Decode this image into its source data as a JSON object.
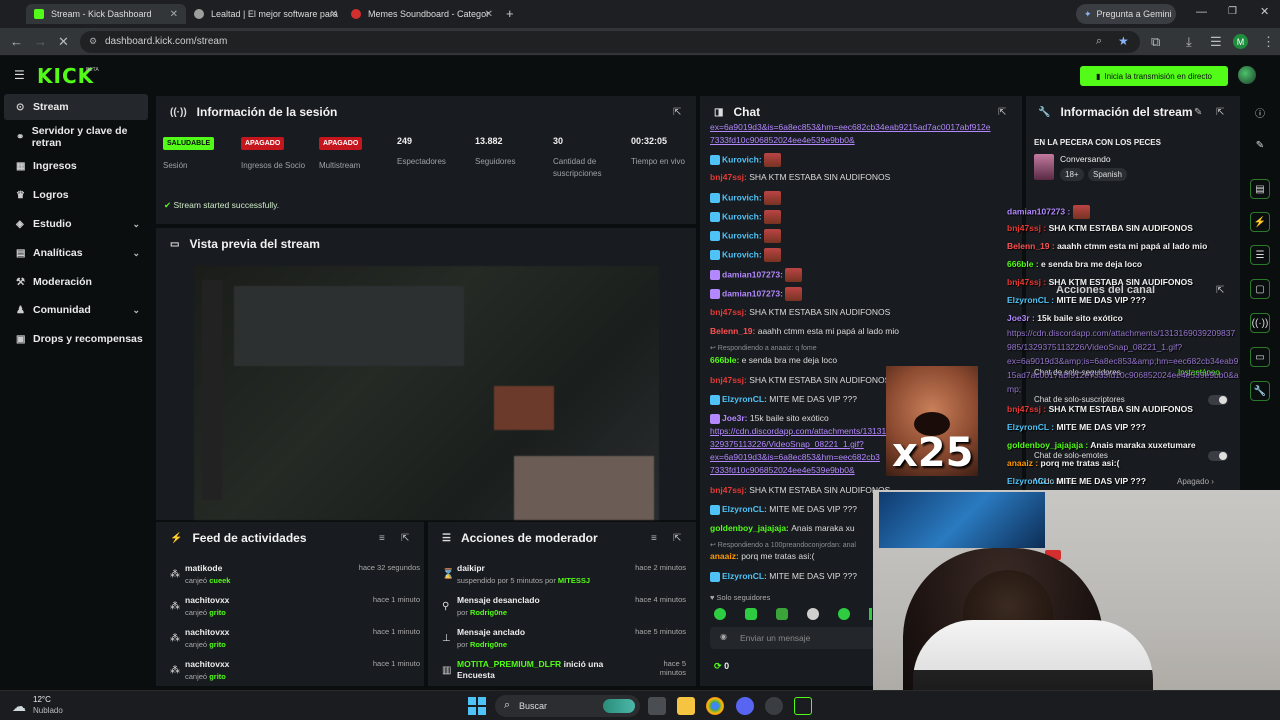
{
  "browser": {
    "tabs": [
      {
        "label": "Stream - Kick Dashboard",
        "active": true
      },
      {
        "label": "Lealtad | El mejor software para"
      },
      {
        "label": "Memes Soundboard - Categor"
      }
    ],
    "gemini_label": "Pregunta a Gemini",
    "url": "dashboard.kick.com/stream",
    "profile_initial": "M"
  },
  "kick": {
    "logo": "KICK",
    "logo_badge": "BETA",
    "go_live_label": "Inicia la transmisión en directo"
  },
  "sidebar": {
    "items": [
      {
        "label": "Stream",
        "active": true
      },
      {
        "label": "Servidor y clave de retran"
      },
      {
        "label": "Ingresos"
      },
      {
        "label": "Logros"
      },
      {
        "label": "Estudio"
      },
      {
        "label": "Analíticas"
      },
      {
        "label": "Moderación"
      },
      {
        "label": "Comunidad"
      },
      {
        "label": "Drops y recompensas"
      }
    ]
  },
  "session": {
    "title": "Información de la sesión",
    "stats": [
      {
        "badge": "SALUDABLE",
        "label": "Sesión",
        "color": "#53fc18"
      },
      {
        "badge": "APAGADO",
        "label": "Ingresos de Socio",
        "color": "#c4161c"
      },
      {
        "badge": "APAGADO",
        "label": "Multistream",
        "color": "#c4161c"
      },
      {
        "value": "249",
        "label": "Espectadores"
      },
      {
        "value": "13.882",
        "label": "Seguidores"
      },
      {
        "value": "30",
        "label": "Cantidad de suscripciones"
      },
      {
        "value": "00:32:05",
        "label": "Tiempo en vivo"
      }
    ],
    "status_message": "Stream started successfully."
  },
  "preview": {
    "title": "Vista previa del stream"
  },
  "feed": {
    "title": "Feed de actividades",
    "items": [
      {
        "user": "matikode",
        "action": "canjeó",
        "reward": "cueek",
        "time": "hace 32 segundos"
      },
      {
        "user": "nachitovxx",
        "action": "canjeó",
        "reward": "grito",
        "time": "hace 1 minuto"
      },
      {
        "user": "nachitovxx",
        "action": "canjeó",
        "reward": "grito",
        "time": "hace 1 minuto"
      },
      {
        "user": "nachitovxx",
        "action": "canjeó",
        "reward": "grito",
        "time": "hace 1 minuto"
      }
    ]
  },
  "modactions": {
    "title": "Acciones de moderador",
    "items": [
      {
        "icon": "hourglass-icon",
        "title": "daikipr",
        "sub": "suspendido por 5 minutos por",
        "by": "MITESSJ",
        "time": "hace 2 minutos"
      },
      {
        "icon": "unpin-icon",
        "title": "Mensaje desanclado",
        "sub": "por",
        "by": "Rodrig0ne",
        "time": "hace 4 minutos"
      },
      {
        "icon": "pin-icon",
        "title": "Mensaje anclado",
        "sub": "por",
        "by": "Rodrig0ne",
        "time": "hace 5 minutos"
      },
      {
        "icon": "poll-icon",
        "title_user": "MOTITA_PREMIUM_DLFR",
        "title_rest": "inició una Encuesta",
        "time": "hace 5 minutos"
      }
    ]
  },
  "chat": {
    "title": "Chat",
    "top_link_1": "ex=6a9019d3&is=6a8ec853&hm=eec682cb34eab9215ad7ac0017abf912e",
    "top_link_2": "7333fd10c906852024ee4e539e9bb0&",
    "lines": [
      {
        "user": "Kurovich:",
        "color": "#4fc3f7",
        "emote": true
      },
      {
        "user": "bnj47ssj:",
        "color": "#e53935",
        "text": "SHA KTM ESTABA SIN AUDIFONOS"
      },
      {
        "user": "Kurovich:",
        "color": "#4fc3f7",
        "emote": true
      },
      {
        "user": "Kurovich:",
        "color": "#4fc3f7",
        "emote": true
      },
      {
        "user": "Kurovich:",
        "color": "#4fc3f7",
        "emote": true
      },
      {
        "user": "Kurovich:",
        "color": "#4fc3f7",
        "emote": true
      },
      {
        "user": "damian107273:",
        "color": "#b388ff",
        "emote": true
      },
      {
        "user": "damian107273:",
        "color": "#b388ff",
        "emote": true
      },
      {
        "user": "bnj47ssj:",
        "color": "#e53935",
        "text": "SHA KTM ESTABA SIN AUDIFONOS"
      },
      {
        "user": "Belenn_19:",
        "color": "#ff5252",
        "text": "aaahh ctmm esta mi papá al lado mio"
      },
      {
        "reply": "Respondiendo a anaaiz: q fome"
      },
      {
        "user": "666ble:",
        "color": "#53fc18",
        "text": "e senda bra me deja loco"
      },
      {
        "user": "bnj47ssj:",
        "color": "#e53935",
        "text": "SHA KTM ESTABA SIN AUDIFONOS"
      },
      {
        "user": "ElzyronCL:",
        "color": "#4fc3f7",
        "text": "MITE ME DAS VIP ???"
      },
      {
        "user": "Joe3r:",
        "color": "#b388ff",
        "text": "15k baile sito exótico"
      },
      {
        "link": "https://cdn.discordapp.com/attachments/13131"
      },
      {
        "link": "329375113226/VideoSnap_08221_1.gif?"
      },
      {
        "link": "ex=6a9019d3&is=6a8ec853&hm=eec682cb3"
      },
      {
        "link": "7333fd10c906852024ee4e539e9bb0&"
      },
      {
        "user": "bnj47ssj:",
        "color": "#e53935",
        "text": "SHA KTM ESTABA SIN AUDIFONOS"
      },
      {
        "user": "ElzyronCL:",
        "color": "#4fc3f7",
        "text": "MITE ME DAS VIP ???"
      },
      {
        "user": "goldenboy_jajajaja:",
        "color": "#53fc18",
        "text": "Anais maraka xu"
      },
      {
        "reply": "Respondiendo a 100preandoconjordan: anal"
      },
      {
        "user": "anaaiz:",
        "color": "#ff9800",
        "text": "porq me tratas asi:("
      },
      {
        "user": "ElzyronCL:",
        "color": "#4fc3f7",
        "text": "MITE ME DAS VIP ???"
      }
    ],
    "followers_only": "Solo seguidores",
    "input_placeholder": "Enviar un mensaje",
    "points": "0"
  },
  "stream_info": {
    "title": "Información del stream",
    "stream_title": "EN LA PECERA CON LOS PECES",
    "category": "Conversando",
    "tags": [
      "18+",
      "Spanish"
    ]
  },
  "channel_actions": {
    "title": "Acciones del canal",
    "items": [
      {
        "label": "Chat de solo-seguidores",
        "value": "Instantáneo"
      },
      {
        "label": "Chat de solo-suscriptores"
      },
      {
        "label": "Chat de solo-emotes"
      },
      {
        "label": "Modo lento",
        "value": "Apagado"
      }
    ]
  },
  "overlay_chat": [
    {
      "user": "damian107273 :",
      "color": "#b388ff",
      "emote": true
    },
    {
      "user": "bnj47ssj :",
      "color": "#e53935",
      "text": "SHA KTM ESTABA SIN AUDIFONOS"
    },
    {
      "user": "Belenn_19 :",
      "color": "#ff5252",
      "text": "aaahh ctmm esta mi papá al lado mio"
    },
    {
      "user": "666ble :",
      "color": "#53fc18",
      "text": "e senda bra me deja loco"
    },
    {
      "user": "bnj47ssj :",
      "color": "#e53935",
      "text": "SHA KTM ESTABA SIN AUDIFONOS"
    },
    {
      "user": "ElzyronCL :",
      "color": "#4fc3f7",
      "text": "MITE ME DAS VIP ???"
    },
    {
      "user": "Joe3r :",
      "color": "#b388ff",
      "text": "15k baile sito exótico"
    },
    {
      "link": "https://cdn.discordapp.com/attachments/1313169039209837"
    },
    {
      "link": "985/1329375113226/VideoSnap_08221_1.gif?"
    },
    {
      "link": "ex=6a9019d3&amp;is=6a8ec853&amp;hm=eec682cb34eab9"
    },
    {
      "link": "15ad7ac0017abf912e7333fd10c906852024ee4e539e9bb0&a"
    },
    {
      "link": "mp;"
    },
    {
      "user": "bnj47ssj :",
      "color": "#e53935",
      "text": "SHA KTM ESTABA SIN AUDIFONOS"
    },
    {
      "user": "ElzyronCL :",
      "color": "#4fc3f7",
      "text": "MITE ME DAS VIP ???"
    },
    {
      "user": "goldenboy_jajajaja :",
      "color": "#53fc18",
      "text": "Anais maraka xuxetumare"
    },
    {
      "user": "anaaiz :",
      "color": "#ff9800",
      "text": "porq me tratas asi:("
    },
    {
      "user": "ElzyronCL :",
      "color": "#4fc3f7",
      "text": "MITE ME DAS VIP ???"
    }
  ],
  "overlay": {
    "meme_text": "x25"
  },
  "taskbar": {
    "weather_temp": "12°C",
    "weather_desc": "Nublado",
    "search_label": "Buscar"
  }
}
